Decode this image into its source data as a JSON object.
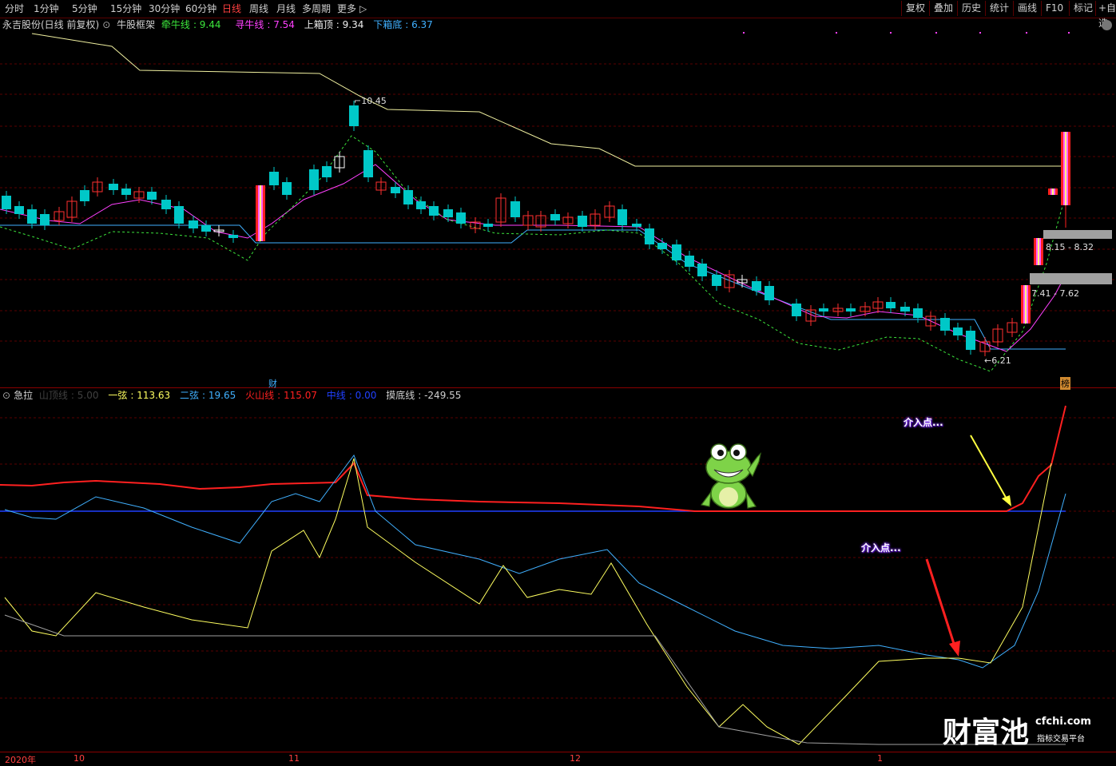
{
  "toolbar": {
    "periods": [
      "分时",
      "1分钟",
      "5分钟",
      "15分钟",
      "30分钟",
      "60分钟",
      "日线",
      "周线",
      "月线",
      "多周期",
      "更多"
    ],
    "active_period": "日线",
    "right_buttons": [
      "复权",
      "叠加",
      "历史",
      "统计",
      "画线",
      "F10",
      "标记",
      "+自选"
    ]
  },
  "main_legend": {
    "stock": "永吉股份(日线 前复权)",
    "indicator": "牛股框架",
    "items": [
      {
        "name": "牵牛线",
        "value": "9.44",
        "color": "#3ce63c"
      },
      {
        "name": "寻牛线",
        "value": "7.54",
        "color": "#ff40ff"
      },
      {
        "name": "上箱顶",
        "value": "9.34",
        "color": "#f0f0f0"
      },
      {
        "name": "下箱底",
        "value": "6.37",
        "color": "#40b0ff"
      }
    ]
  },
  "main_chart": {
    "high_label": "10.45",
    "low_label": "6.21",
    "zone_upper": "8.15 - 8.32",
    "zone_lower": "7.41 - 7.62",
    "marker_cai": "财",
    "marker_bang": "榜"
  },
  "sub_legend": {
    "indicator": "急拉",
    "items": [
      {
        "name": "山顶线",
        "value": "5.00",
        "color": "#404040"
      },
      {
        "name": "一弦",
        "value": "113.63",
        "color": "#ffff60"
      },
      {
        "name": "二弦",
        "value": "19.65",
        "color": "#40b0ff"
      },
      {
        "name": "火山线",
        "value": "115.07",
        "color": "#ff2020"
      },
      {
        "name": "中线",
        "value": "0.00",
        "color": "#2040ff"
      },
      {
        "name": "摸底线",
        "value": "-249.55",
        "color": "#d0d0d0"
      }
    ]
  },
  "annotations": {
    "entry_point_1": "介入点...",
    "entry_point_2": "介入点..."
  },
  "date_axis": [
    "2020年",
    "10",
    "11",
    "12",
    "1"
  ],
  "brand": {
    "name": "财富池",
    "url": "cfchi.com",
    "subtitle": "指标交易平台"
  }
}
